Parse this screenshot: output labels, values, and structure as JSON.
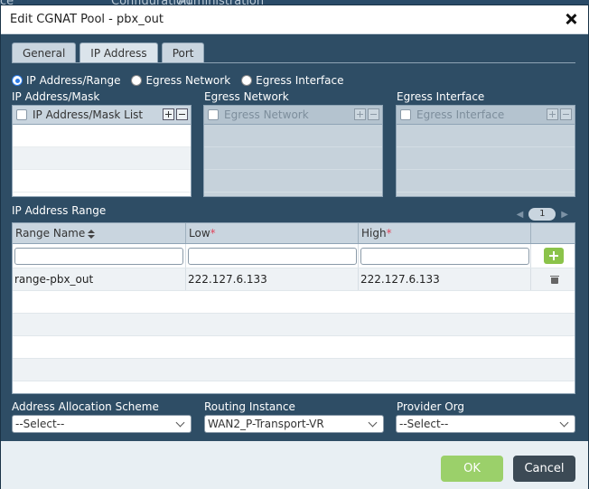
{
  "background_tabs": [
    "Configuration",
    "Administration"
  ],
  "dialog": {
    "title": "Edit CGNAT Pool - pbx_out",
    "close_label": "close"
  },
  "tabs": [
    {
      "label": "General",
      "active": false
    },
    {
      "label": "IP Address",
      "active": true
    },
    {
      "label": "Port",
      "active": false
    }
  ],
  "source_type": {
    "options": [
      "IP Address/Range",
      "Egress Network",
      "Egress Interface"
    ],
    "selected": "IP Address/Range"
  },
  "ip_mask": {
    "section_label": "IP Address/Mask",
    "column": "IP Address/Mask List"
  },
  "egress_network": {
    "section_label": "Egress Network",
    "column": "Egress Network"
  },
  "egress_interface": {
    "section_label": "Egress Interface",
    "column": "Egress Interface"
  },
  "range": {
    "section_label": "IP Address Range",
    "page": "1",
    "columns": {
      "name": "Range Name",
      "low": "Low",
      "high": "High",
      "required_mark": "*"
    },
    "rows": [
      {
        "name": "range-pbx_out",
        "low": "222.127.6.133",
        "high": "222.127.6.133"
      }
    ]
  },
  "selects": {
    "allocation": {
      "label": "Address Allocation Scheme",
      "value": "--Select--"
    },
    "routing": {
      "label": "Routing Instance",
      "value": "WAN2_P-Transport-VR"
    },
    "provider": {
      "label": "Provider Org",
      "value": "--Select--"
    }
  },
  "buttons": {
    "ok": "OK",
    "cancel": "Cancel"
  },
  "colors": {
    "ok": "#9bd06a",
    "cancel": "#3c4a55",
    "add": "#8bc34a",
    "dialog_bg": "#2e4d65"
  }
}
